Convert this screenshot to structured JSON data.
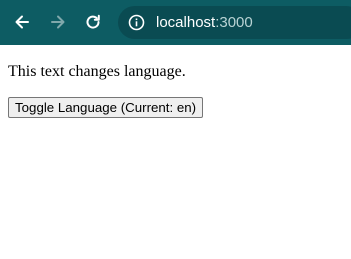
{
  "browser": {
    "address_host": "localhost",
    "address_port": ":3000",
    "toolbar_color": "#0d5c63",
    "icons": [
      "back-arrow-icon",
      "forward-arrow-icon",
      "reload-icon",
      "site-info-icon"
    ]
  },
  "page": {
    "paragraph": "This text changes language.",
    "toggle_button_label": "Toggle Language (Current: en)"
  }
}
